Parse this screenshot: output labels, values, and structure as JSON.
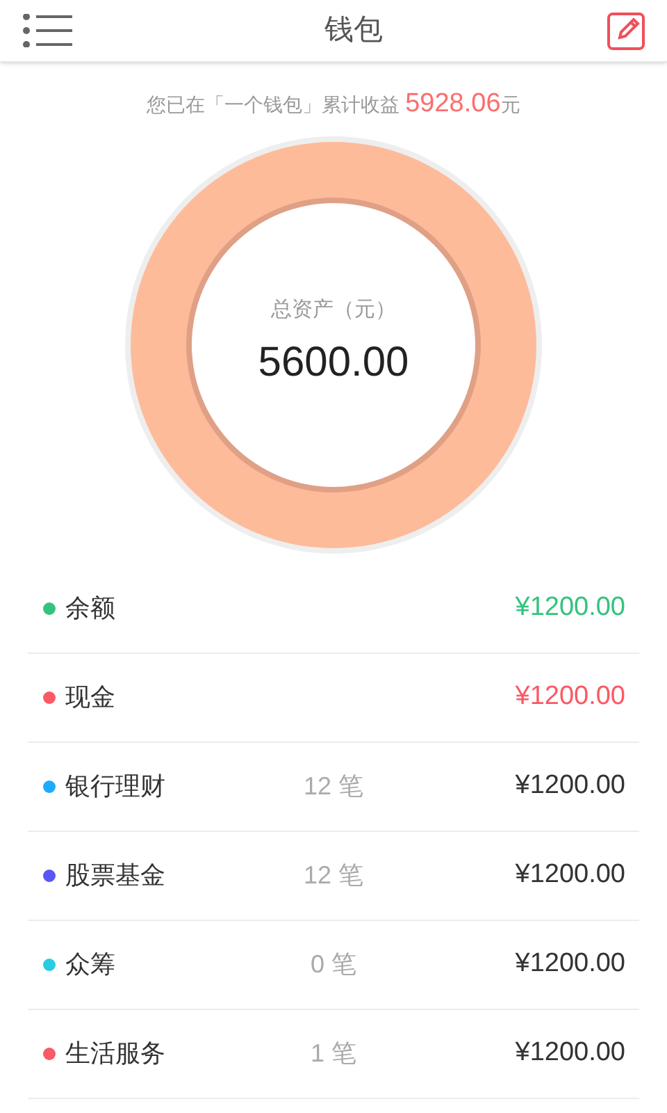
{
  "header": {
    "title": "钱包"
  },
  "summary": "您已在「一个钱包」累计收益 **5928.06**元",
  "total": {
    "label": "总资产（元）",
    "value": "5600.00"
  },
  "accounts": [
    {
      "name": "余额",
      "amount": "¥1200.00",
      "color": "#34c37e",
      "highlight": true
    },
    {
      "name": "现金",
      "amount": "¥1200.00",
      "color": "#fa5a64",
      "highlight": true
    },
    {
      "name": "银行理财",
      "count": "12 笔",
      "amount": "¥1200.00",
      "color": "#1eaaff",
      "highlight": false
    },
    {
      "name": "股票基金",
      "count": "12 笔",
      "amount": "¥1200.00",
      "color": "#5a55f5",
      "highlight": false
    },
    {
      "name": "众筹",
      "count": "0 笔",
      "amount": "¥1200.00",
      "color": "#28cde1",
      "highlight": false
    },
    {
      "name": "生活服务",
      "count": "1 笔",
      "amount": "¥1200.00",
      "color": "#fa5a64",
      "highlight": false
    }
  ]
}
